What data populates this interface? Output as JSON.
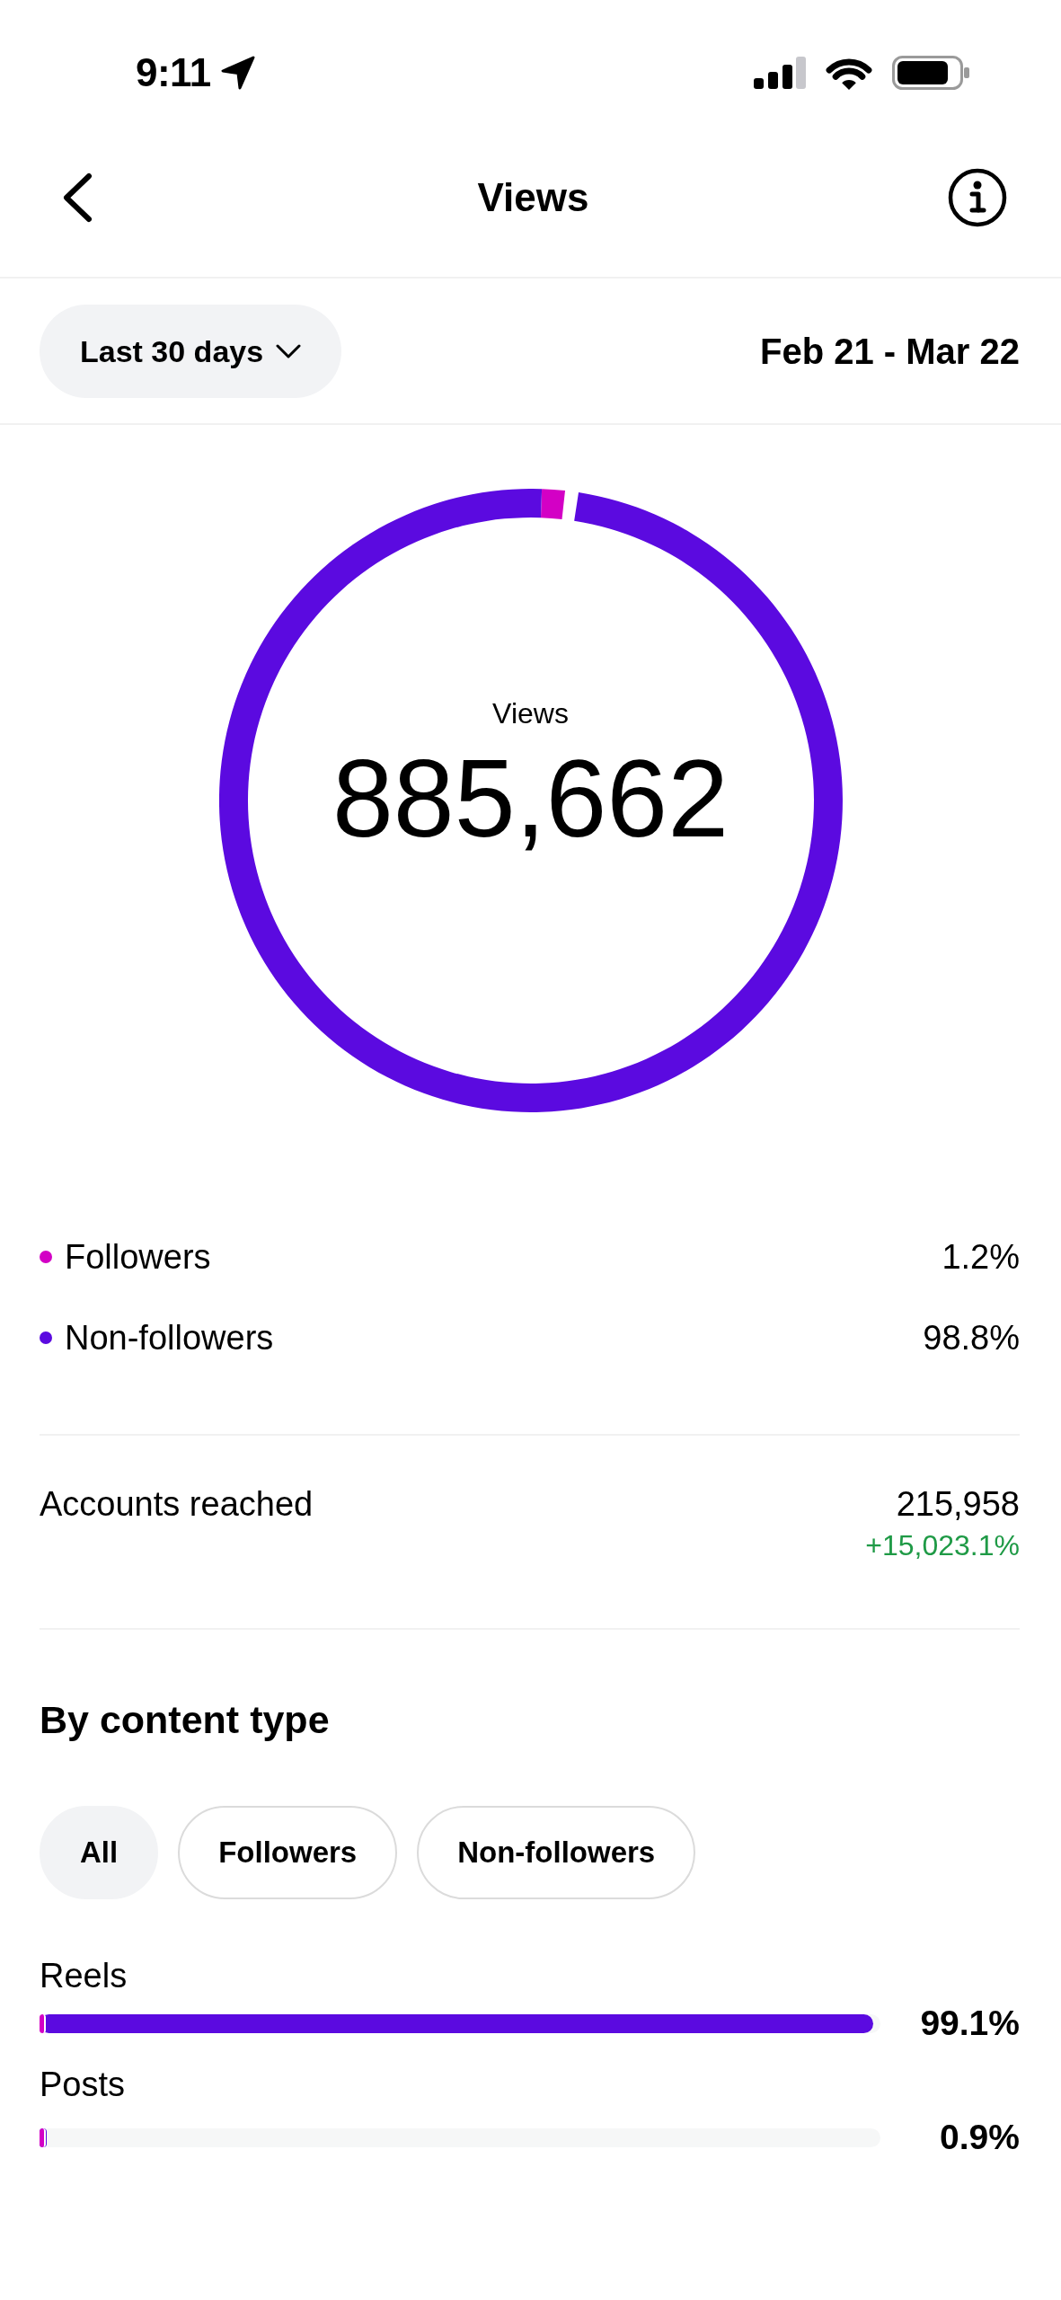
{
  "status_bar": {
    "time": "9:11"
  },
  "header": {
    "title": "Views"
  },
  "filter": {
    "period": "Last 30 days",
    "date_range": "Feb 21 - Mar 22"
  },
  "summary": {
    "chart_data": {
      "type": "donut",
      "title": "Views",
      "values": [
        1.2,
        98.8
      ]
    },
    "total": "885,662",
    "legend": [
      {
        "label": "Followers",
        "value": "1.2%",
        "color": "#d300c5"
      },
      {
        "label": "Non-followers",
        "value": "98.8%",
        "color": "#5b0ae0"
      }
    ]
  },
  "metrics": [
    {
      "label": "Accounts reached",
      "value": "215,958",
      "change": "+15,023.1%"
    }
  ],
  "content_type": {
    "title": "By content type",
    "chips": [
      {
        "label": "All",
        "selected": true
      },
      {
        "label": "Followers",
        "selected": false
      },
      {
        "label": "Non-followers",
        "selected": false
      }
    ],
    "rows": [
      {
        "label": "Reels",
        "value": "99.1%",
        "segments": [
          {
            "color": "#d300c5",
            "level": 0.007
          },
          {
            "color": "#5b0ae0",
            "level": 0.991
          }
        ]
      },
      {
        "label": "Posts",
        "value": "0.9%",
        "segments": [
          {
            "color": "#d300c5",
            "level": 0.007
          },
          {
            "color": "#5b0ae0",
            "level": 0.009
          }
        ]
      }
    ]
  }
}
